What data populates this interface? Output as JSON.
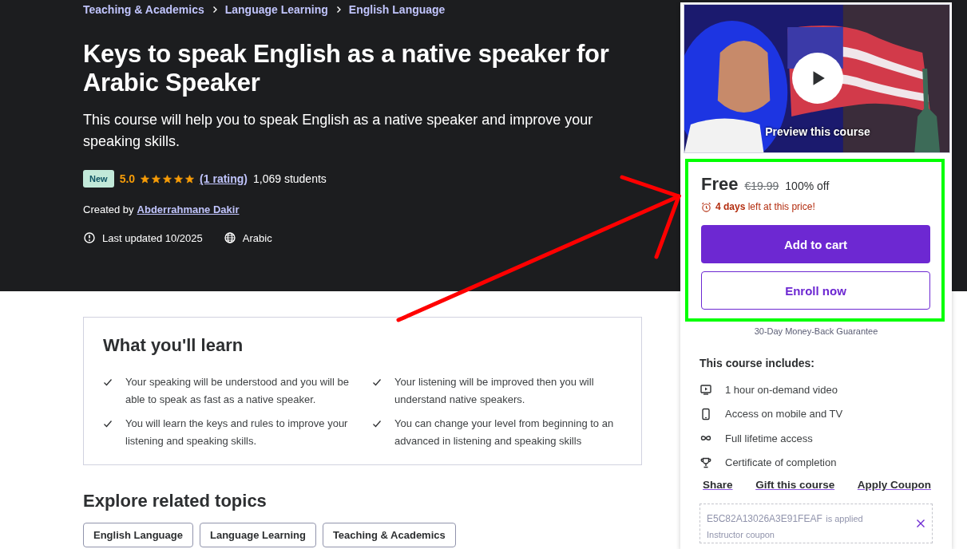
{
  "breadcrumbs": [
    "Teaching & Academics",
    "Language Learning",
    "English Language"
  ],
  "title": "Keys to speak English as a native speaker for Arabic Speaker",
  "subtitle": "This course will help you to speak English as a native speaker and improve your speaking skills.",
  "badge": "New",
  "rating": "5.0",
  "stars": 5,
  "rating_count": "(1 rating)",
  "students": "1,069 students",
  "created_by_label": "Created by",
  "instructor": "Abderrahmane Dakir",
  "meta": [
    {
      "kind": "updated",
      "text": "Last updated 10/2025"
    },
    {
      "kind": "language",
      "text": "Arabic"
    }
  ],
  "learn": {
    "title": "What you'll learn",
    "items": [
      "Your speaking will be understood and you will be able to speak as fast as a native speaker.",
      "Your listening will be improved then you will understand native speakers.",
      "You will learn the keys and rules to improve your listening and speaking skills.",
      "You can change your level from beginning to an advanced in listening and speaking skills"
    ]
  },
  "related": {
    "title": "Explore related topics",
    "topics": [
      "English Language",
      "Language Learning",
      "Teaching & Academics"
    ]
  },
  "sidebar": {
    "preview": {
      "kind": "picture",
      "label": "Preview this course"
    },
    "price": "Free",
    "original_price": "€19.99",
    "discount": "100% off",
    "deadline_strong": "4 days",
    "deadline_rest": "left at this price!",
    "buttons": [
      {
        "kind": "primary",
        "label": "Add to cart"
      },
      {
        "kind": "outline",
        "label": "Enroll now"
      }
    ],
    "guarantee": "30-Day Money-Back Guarantee",
    "includes_title": "This course includes:",
    "includes": [
      {
        "kind": "video",
        "text": "1 hour on-demand video"
      },
      {
        "kind": "mobile",
        "text": "Access on mobile and TV"
      },
      {
        "kind": "infinity",
        "text": "Full lifetime access"
      },
      {
        "kind": "trophy",
        "text": "Certificate of completion"
      }
    ],
    "links": [
      "Share",
      "Gift this course",
      "Apply Coupon"
    ],
    "coupon": {
      "code": "E5C82A13026A3E91FEAF",
      "status": "is applied",
      "note": "Instructor coupon"
    }
  }
}
